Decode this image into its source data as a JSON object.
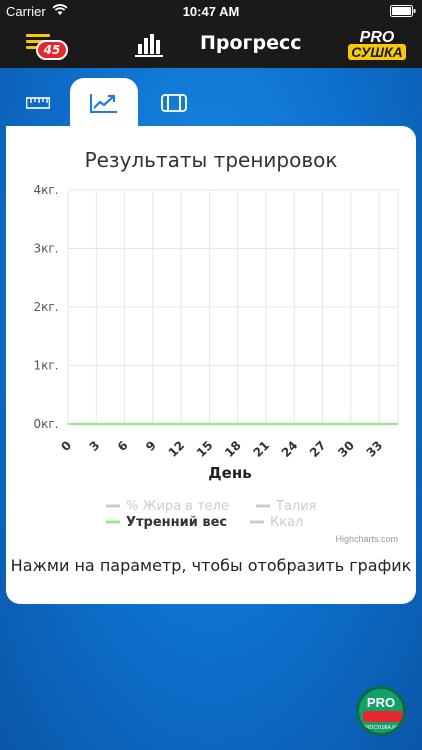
{
  "status_bar": {
    "carrier": "Carrier",
    "time": "10:47 AM"
  },
  "nav": {
    "badge_count": "45",
    "title": "Прогресс",
    "logo_top": "PRO",
    "logo_bottom": "СУШКА"
  },
  "tabs": [
    {
      "name": "ruler-tab",
      "icon": "ruler-icon",
      "active": false
    },
    {
      "name": "progress-tab",
      "icon": "trend-chart-icon",
      "active": true
    },
    {
      "name": "measure-tab",
      "icon": "body-measure-icon",
      "active": false
    }
  ],
  "colors": {
    "accent_yellow": "#f6c90e",
    "badge_red": "#e8262b",
    "series_green": "#90ed7d",
    "legend_gray": "#cccccc",
    "nav_bg": "#1a1a1a"
  },
  "chart_data": {
    "type": "line",
    "title": "Результаты тренировок",
    "xlabel": "День",
    "ylabel": "",
    "y_ticks": [
      "0кг.",
      "1кг.",
      "2кг.",
      "3кг.",
      "4кг."
    ],
    "x_ticks": [
      "0",
      "3",
      "6",
      "9",
      "12",
      "15",
      "18",
      "21",
      "24",
      "27",
      "30",
      "33"
    ],
    "xlim": [
      0,
      35
    ],
    "ylim": [
      0,
      4
    ],
    "grid": true,
    "legend_position": "bottom",
    "series": [
      {
        "name": "% Жира в теле",
        "visible": false,
        "color": "#cccccc",
        "values": []
      },
      {
        "name": "Талия",
        "visible": false,
        "color": "#cccccc",
        "values": []
      },
      {
        "name": "Утренний вес",
        "visible": true,
        "color": "#90ed7d",
        "x": [
          0,
          35
        ],
        "values": [
          0,
          0
        ]
      },
      {
        "name": "Ккал",
        "visible": false,
        "color": "#cccccc",
        "values": []
      }
    ]
  },
  "credits": "Highcharts.com",
  "hint": "Нажми на параметр, чтобы отобразить график",
  "fab": {
    "top": "PRO",
    "bottom": "СУШКА",
    "caption": "PROСУШКА.РФ"
  }
}
